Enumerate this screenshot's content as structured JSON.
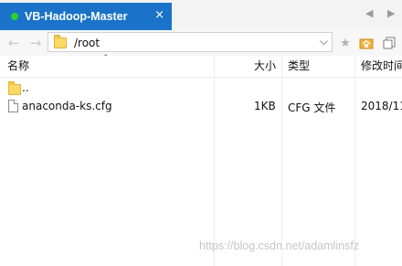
{
  "tab": {
    "title": "VB-Hadoop-Master",
    "close": "×",
    "status_color": "#2bd22b",
    "accent": "#1a73c8"
  },
  "tab_nav": {
    "prev": "◀",
    "next": "▶"
  },
  "toolbar": {
    "back": "←",
    "forward": "→",
    "path": "/root",
    "dropdown": "⌵",
    "icons": [
      "star-icon",
      "home-folder-icon",
      "copy-icon"
    ]
  },
  "columns": {
    "name": "名称",
    "size": "大小",
    "type": "类型",
    "modified": "修改时间"
  },
  "files": [
    {
      "name": "..",
      "size": "",
      "type": "",
      "modified": "",
      "kind": "parent-folder"
    },
    {
      "name": "anaconda-ks.cfg",
      "size": "1KB",
      "type": "CFG 文件",
      "modified": "2018/11",
      "kind": "file"
    }
  ],
  "watermark": "https://blog.csdn.net/adamlinsfz"
}
